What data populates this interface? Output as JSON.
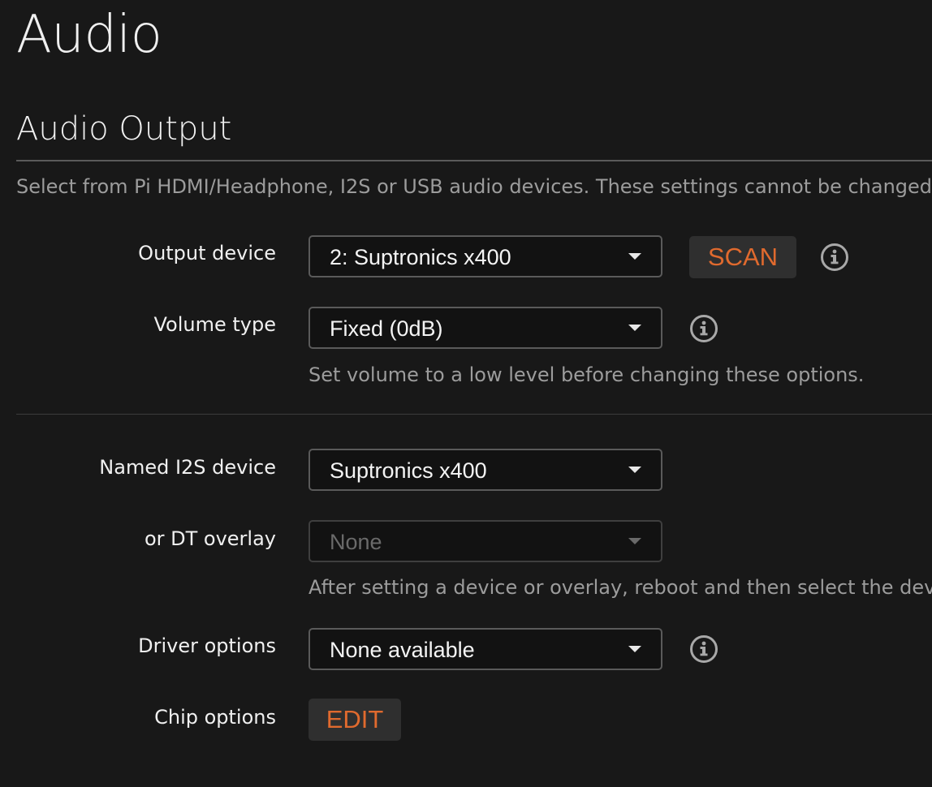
{
  "page": {
    "title": "Audio"
  },
  "section": {
    "title": "Audio Output",
    "description": "Select from Pi HDMI/Headphone, I2S or USB audio devices. These settings cannot be changed wh"
  },
  "output_device": {
    "label": "Output device",
    "value": "2: Suptronics x400",
    "scan_label": "SCAN",
    "info_icon": "info-icon"
  },
  "volume_type": {
    "label": "Volume type",
    "value": "Fixed (0dB)",
    "info_icon": "info-icon",
    "hint": "Set volume to a low level before changing these options."
  },
  "named_i2s": {
    "label": "Named I2S device",
    "value": "Suptronics x400"
  },
  "dt_overlay": {
    "label": "or DT overlay",
    "value": "None",
    "disabled": true,
    "hint": "After setting a device or overlay, reboot and then select the device"
  },
  "driver_options": {
    "label": "Driver options",
    "value": "None available",
    "info_icon": "info-icon"
  },
  "chip_options": {
    "label": "Chip options",
    "edit_label": "EDIT"
  },
  "colors": {
    "background": "#181818",
    "accent": "#e06a2e",
    "muted_text": "#9c9c9c",
    "border": "#5a5a5a"
  }
}
